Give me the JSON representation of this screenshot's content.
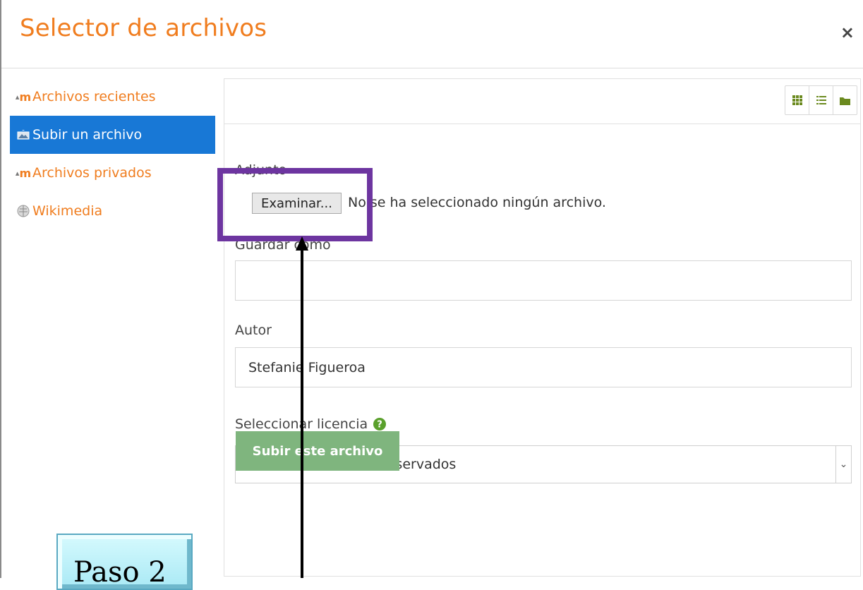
{
  "header": {
    "title": "Selector de archivos",
    "close_glyph": "×"
  },
  "sidebar": {
    "items": [
      {
        "label": "Archivos recientes",
        "icon": "moodle-icon",
        "active": false
      },
      {
        "label": "Subir un archivo",
        "icon": "upload-icon",
        "active": true
      },
      {
        "label": "Archivos privados",
        "icon": "moodle-icon",
        "active": false
      },
      {
        "label": "Wikimedia",
        "icon": "wikimedia-icon",
        "active": false
      }
    ]
  },
  "toolbar": {
    "view_icons": [
      "grid-view-icon",
      "list-view-icon",
      "folder-view-icon"
    ]
  },
  "form": {
    "attachment_label": "Adjunto",
    "browse_button": "Examinar...",
    "no_file_text": "No se ha seleccionado ningún archivo.",
    "save_as_label": "Guardar como",
    "save_as_value": "",
    "author_label": "Autor",
    "author_value": "Stefanie Figueroa",
    "license_label": "Seleccionar licencia",
    "license_value": "Todos los derechos reservados",
    "submit_label": "Subir este archivo"
  },
  "annotation": {
    "step_label": "Paso 2"
  },
  "colors": {
    "accent": "#f07d1f",
    "active_bg": "#1878d6",
    "submit_bg": "#7fb57e",
    "highlight": "#6d35a0"
  }
}
